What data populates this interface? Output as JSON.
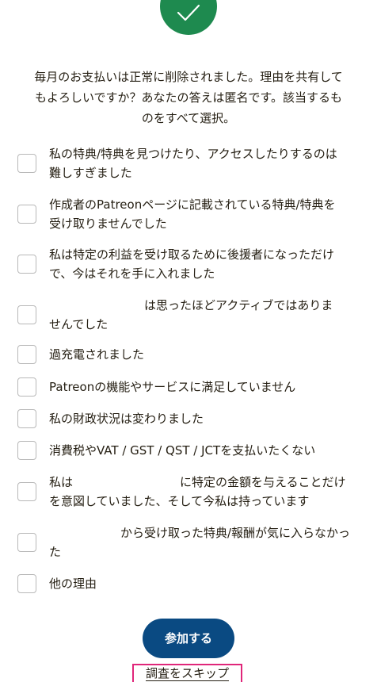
{
  "header": {
    "check_icon": "checkmark-icon",
    "accent_color": "#1e8a4f"
  },
  "message": {
    "line1": "毎月のお支払いは正常に削除されました。理由を共有して",
    "line2": "もよろしいですか？あなたの答えは匿名です。該当するも",
    "line3": "のをすべて選択。"
  },
  "options": [
    {
      "line1": "私の特典/特典を見つけたり、アクセスしたりするのは",
      "line2": "難しすぎました"
    },
    {
      "line1": "作成者のPatreonページに記載されている特典/特典を",
      "line2": "受け取りませんでした"
    },
    {
      "line1": "私は特定の利益を受け取るために後援者になっただけ",
      "line2": "で、今はそれを手に入れました"
    },
    {
      "line1": "　　　　　　　　は思ったほどアクティブではありま",
      "line2": "せんでした"
    },
    {
      "line1": "過充電されました"
    },
    {
      "line1": "Patreonの機能やサービスに満足していません"
    },
    {
      "line1": "私の財政状況は変わりました"
    },
    {
      "line1": "消費税やVAT / GST / QST / JCTを支払いたくない"
    },
    {
      "line1": "私は　　　　　　　　　に特定の金額を与えることだけ",
      "line2": "を意図していました、そして今私は持っています"
    },
    {
      "line1": "　　　　　　から受け取った特典/報酬が気に入らなかっ",
      "line2": "た"
    },
    {
      "line1": "他の理由"
    }
  ],
  "actions": {
    "join_label": "参加する",
    "skip_label": "調査をスキップ",
    "button_color": "#0a4a82",
    "highlight_color": "#e0267a"
  }
}
